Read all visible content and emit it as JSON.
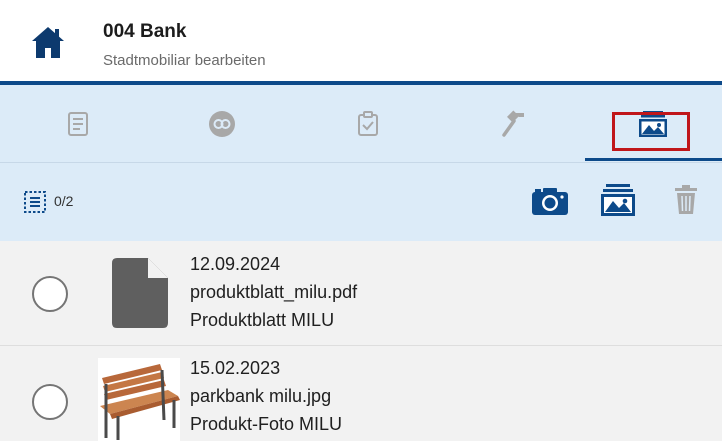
{
  "header": {
    "title": "004 Bank",
    "subtitle": "Stadtmobiliar bearbeiten"
  },
  "tabs": [
    {
      "icon": "document-icon",
      "active": false
    },
    {
      "icon": "link-circle-icon",
      "active": false
    },
    {
      "icon": "clipboard-check-icon",
      "active": false
    },
    {
      "icon": "hammer-icon",
      "active": false
    },
    {
      "icon": "gallery-icon",
      "active": true
    }
  ],
  "toolbar": {
    "count": "0/2",
    "icons": [
      "select-all-icon",
      "camera-icon",
      "gallery-icon",
      "trash-icon"
    ]
  },
  "items": [
    {
      "date": "12.09.2024",
      "filename": "produktblatt_milu.pdf",
      "description": "Produktblatt MILU",
      "type": "file-icon"
    },
    {
      "date": "15.02.2023",
      "filename": "parkbank milu.jpg",
      "description": "Produkt-Foto MILU",
      "type": "image-thumbnail"
    }
  ],
  "colors": {
    "primary": "#0d4a8a",
    "tab_background": "#dcebf8",
    "highlight": "#c0161a",
    "row_background": "#f2f2f2",
    "inactive_icon": "#9e9e9e"
  }
}
